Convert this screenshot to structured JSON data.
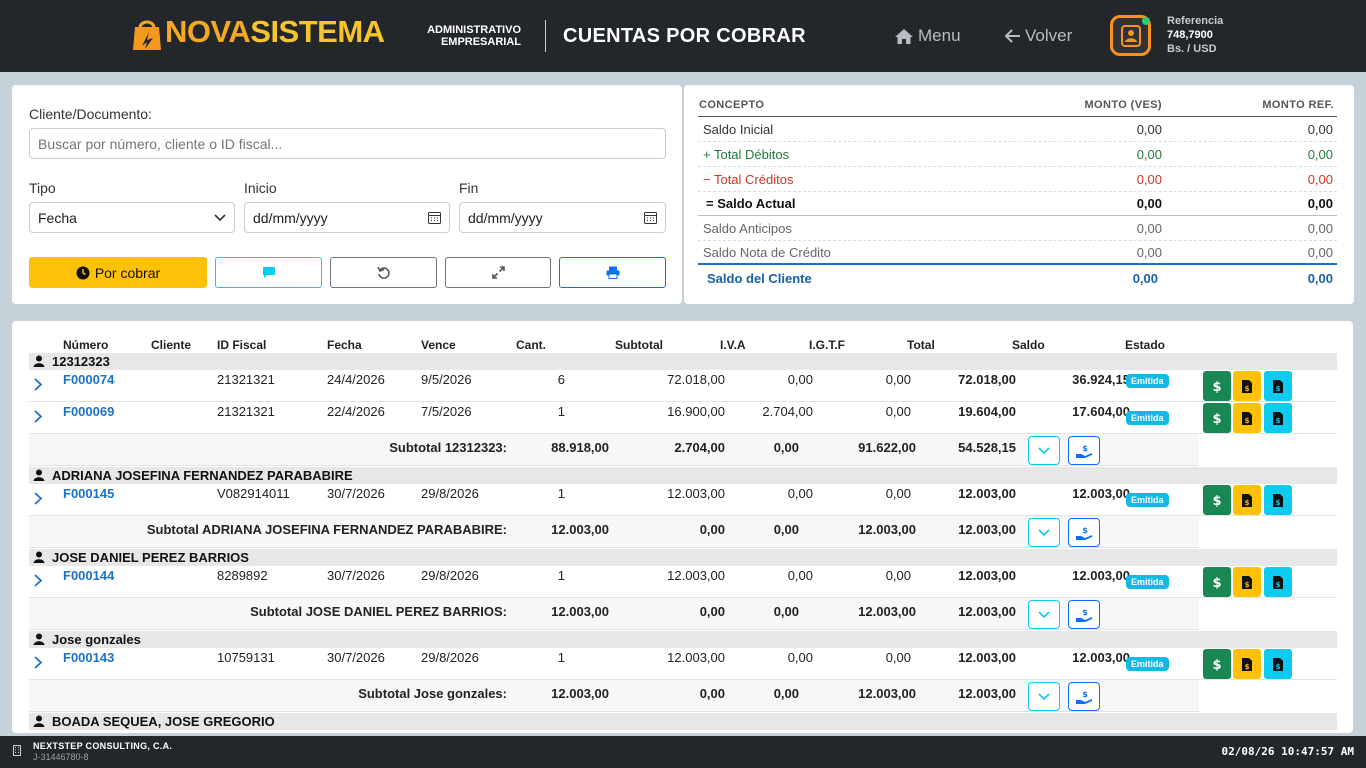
{
  "header": {
    "brand_nova": "NOVA",
    "brand_sistema": "SISTEMA",
    "subtitle_line1": "ADMINISTRATIVO",
    "subtitle_line2": "EMPRESARIAL",
    "page_title": "CUENTAS POR COBRAR",
    "menu_label": "Menu",
    "back_label": "Volver",
    "ref_label": "Referencia",
    "ref_value": "748,7900",
    "ref_unit": "Bs. / USD"
  },
  "filters": {
    "cliente_label": "Cliente/Documento:",
    "search_placeholder": "Buscar por número, cliente o ID fiscal...",
    "tipo_label": "Tipo",
    "tipo_value": "Fecha",
    "inicio_label": "Inicio",
    "inicio_value": "dd/mm/yyyy",
    "fin_label": "Fin",
    "fin_value": "dd/mm/yyyy",
    "por_cobrar_label": "Por cobrar"
  },
  "summary": {
    "headers": {
      "concepto": "CONCEPTO",
      "monto_ves": "MONTO (VES)",
      "monto_ref": "MONTO REF."
    },
    "rows": [
      {
        "concepto": "Saldo Inicial",
        "ves": "0,00",
        "ref": "0,00"
      },
      {
        "concepto": "+ Total Débitos",
        "ves": "0,00",
        "ref": "0,00"
      },
      {
        "concepto": "− Total Créditos",
        "ves": "0,00",
        "ref": "0,00"
      },
      {
        "concepto": "= Saldo Actual",
        "ves": "0,00",
        "ref": "0,00"
      },
      {
        "concepto": "Saldo Anticipos",
        "ves": "0,00",
        "ref": "0,00"
      },
      {
        "concepto": "Saldo Nota de Crédito",
        "ves": "0,00",
        "ref": "0,00"
      }
    ],
    "total": {
      "concepto": "Saldo del Cliente",
      "ves": "0,00",
      "ref": "0,00"
    }
  },
  "colors": {
    "debit": "#1f7a3a",
    "credit": "#d0342c",
    "accent": "#1a5fa8",
    "brand": "#f7a823"
  },
  "table": {
    "headers": {
      "numero": "Número",
      "cliente": "Cliente",
      "id_fiscal": "ID Fiscal",
      "fecha": "Fecha",
      "vence": "Vence",
      "cant": "Cant.",
      "subtotal": "Subtotal",
      "iva": "I.V.A",
      "igtf": "I.G.T.F",
      "total": "Total",
      "saldo": "Saldo",
      "estado": "Estado"
    },
    "groups": [
      {
        "name": "12312323",
        "docs": [
          {
            "numero": "F000074",
            "id_fiscal": "21321321",
            "fecha": "24/4/2026",
            "vence": "9/5/2026",
            "cant": "6",
            "subtotal": "72.018,00",
            "iva": "0,00",
            "igtf": "0,00",
            "total": "72.018,00",
            "saldo": "36.924,15",
            "estado": "Emitida"
          },
          {
            "numero": "F000069",
            "id_fiscal": "21321321",
            "fecha": "22/4/2026",
            "vence": "7/5/2026",
            "cant": "1",
            "subtotal": "16.900,00",
            "iva": "2.704,00",
            "igtf": "0,00",
            "total": "19.604,00",
            "saldo": "17.604,00",
            "estado": "Emitida"
          }
        ],
        "subtotal": {
          "label": "Subtotal 12312323:",
          "subtotal": "88.918,00",
          "iva": "2.704,00",
          "igtf": "0,00",
          "total": "91.622,00",
          "saldo": "54.528,15"
        }
      },
      {
        "name": "ADRIANA JOSEFINA FERNANDEZ PARABABIRE",
        "docs": [
          {
            "numero": "F000145",
            "id_fiscal": "V082914011",
            "fecha": "30/7/2026",
            "vence": "29/8/2026",
            "cant": "1",
            "subtotal": "12.003,00",
            "iva": "0,00",
            "igtf": "0,00",
            "total": "12.003,00",
            "saldo": "12.003,00",
            "estado": "Emitida"
          }
        ],
        "subtotal": {
          "label": "Subtotal ADRIANA JOSEFINA FERNANDEZ PARABABIRE:",
          "subtotal": "12.003,00",
          "iva": "0,00",
          "igtf": "0,00",
          "total": "12.003,00",
          "saldo": "12.003,00"
        }
      },
      {
        "name": "JOSE DANIEL PEREZ BARRIOS",
        "docs": [
          {
            "numero": "F000144",
            "id_fiscal": "8289892",
            "fecha": "30/7/2026",
            "vence": "29/8/2026",
            "cant": "1",
            "subtotal": "12.003,00",
            "iva": "0,00",
            "igtf": "0,00",
            "total": "12.003,00",
            "saldo": "12.003,00",
            "estado": "Emitida"
          }
        ],
        "subtotal": {
          "label": "Subtotal JOSE DANIEL PEREZ BARRIOS:",
          "subtotal": "12.003,00",
          "iva": "0,00",
          "igtf": "0,00",
          "total": "12.003,00",
          "saldo": "12.003,00"
        }
      },
      {
        "name": "Jose gonzales",
        "docs": [
          {
            "numero": "F000143",
            "id_fiscal": "10759131",
            "fecha": "30/7/2026",
            "vence": "29/8/2026",
            "cant": "1",
            "subtotal": "12.003,00",
            "iva": "0,00",
            "igtf": "0,00",
            "total": "12.003,00",
            "saldo": "12.003,00",
            "estado": "Emitida"
          }
        ],
        "subtotal": {
          "label": "Subtotal Jose gonzales:",
          "subtotal": "12.003,00",
          "iva": "0,00",
          "igtf": "0,00",
          "total": "12.003,00",
          "saldo": "12.003,00"
        }
      },
      {
        "name": "BOADA SEQUEA, JOSE GREGORIO",
        "docs": [],
        "subtotal": null
      }
    ]
  },
  "footer": {
    "company": "NEXTSTEP CONSULTING, C.A.",
    "rif": "J-31446780-8",
    "datetime": "02/08/26 10:47:57 AM"
  }
}
